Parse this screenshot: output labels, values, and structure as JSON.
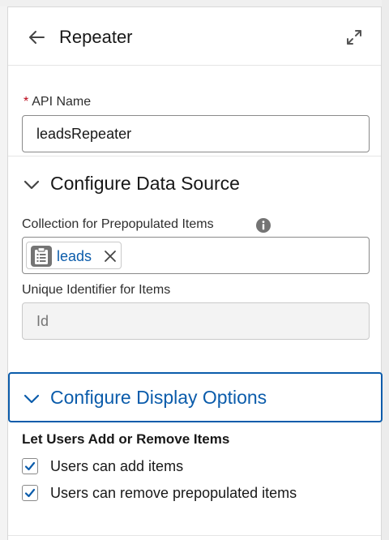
{
  "header": {
    "title": "Repeater",
    "back_icon": "arrow-left-icon",
    "expand_icon": "expand-icon"
  },
  "api_name": {
    "required_marker": "*",
    "label": "API Name",
    "value": "leadsRepeater"
  },
  "data_source": {
    "title": "Configure Data Source",
    "collection_label": "Collection for Prepopulated Items",
    "info_icon": "info-icon",
    "collection_pill": {
      "icon": "clipboard-list-icon",
      "label": "leads"
    },
    "unique_id_label": "Unique Identifier for Items",
    "unique_id_placeholder": "Id"
  },
  "display_options": {
    "title": "Configure Display Options",
    "subheading": "Let Users Add or Remove Items",
    "checkboxes": [
      {
        "label": "Users can add items",
        "checked": true
      },
      {
        "label": "Users can remove prepopulated items",
        "checked": true
      }
    ]
  },
  "colors": {
    "accent": "#0b5cab",
    "required": "#ba0517",
    "border": "#8a8a8a"
  }
}
